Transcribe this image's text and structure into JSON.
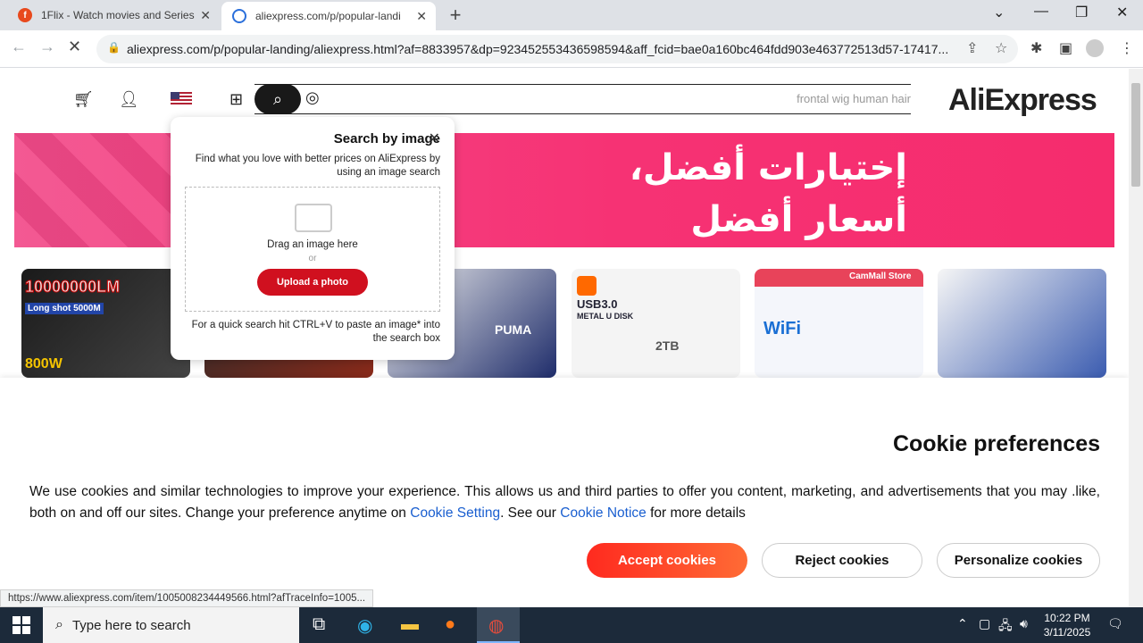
{
  "browser": {
    "tabs": [
      {
        "title": "1Flix - Watch movies and Series"
      },
      {
        "title": "aliexpress.com/p/popular-landi"
      }
    ],
    "url": "aliexpress.com/p/popular-landing/aliexpress.html?af=8833957&dp=923452553436598594&aff_fcid=bae0a160bc464fdd903e463772513d57-17417..."
  },
  "header": {
    "search_placeholder": "frontal wig human hair",
    "logo": "AliExpress"
  },
  "banner": {
    "line1": "إختيارات أفضل،",
    "line2": "أسعار أفضل"
  },
  "products": [
    {
      "label": "10000000LM",
      "sub": "Long shot 5000M",
      "extra": "800W"
    },
    {
      "label": ""
    },
    {
      "label": "PUMA"
    },
    {
      "label": "USB3.0",
      "sub": "METAL U DISK",
      "extra": "2TB"
    },
    {
      "label": "CamMall Store",
      "sub": "WiFi"
    },
    {
      "label": ""
    }
  ],
  "image_search": {
    "title": "Search by image",
    "desc": "Find what you love with better prices on AliExpress by using an image search",
    "drag": "Drag an image here",
    "or": "or",
    "upload": "Upload a photo",
    "hint": "For a quick search hit CTRL+V to paste an image* into the search box"
  },
  "cookie": {
    "title": "Cookie preferences",
    "body_1": "We use cookies and similar technologies to improve your experience. This allows us and third parties to offer you content, marketing, and advertisements that you may .like, both on and off our sites. Change your preference anytime on ",
    "link_1": "Cookie Setting",
    "body_2": ". See our ",
    "link_2": "Cookie Notice",
    "body_3": " for more details",
    "accept": "Accept cookies",
    "reject": "Reject cookies",
    "personalize": "Personalize cookies"
  },
  "status_url": "https://www.aliexpress.com/item/1005008234449566.html?afTraceInfo=1005...",
  "taskbar": {
    "search_placeholder": "Type here to search",
    "time": "10:22 PM",
    "date": "3/11/2025"
  }
}
